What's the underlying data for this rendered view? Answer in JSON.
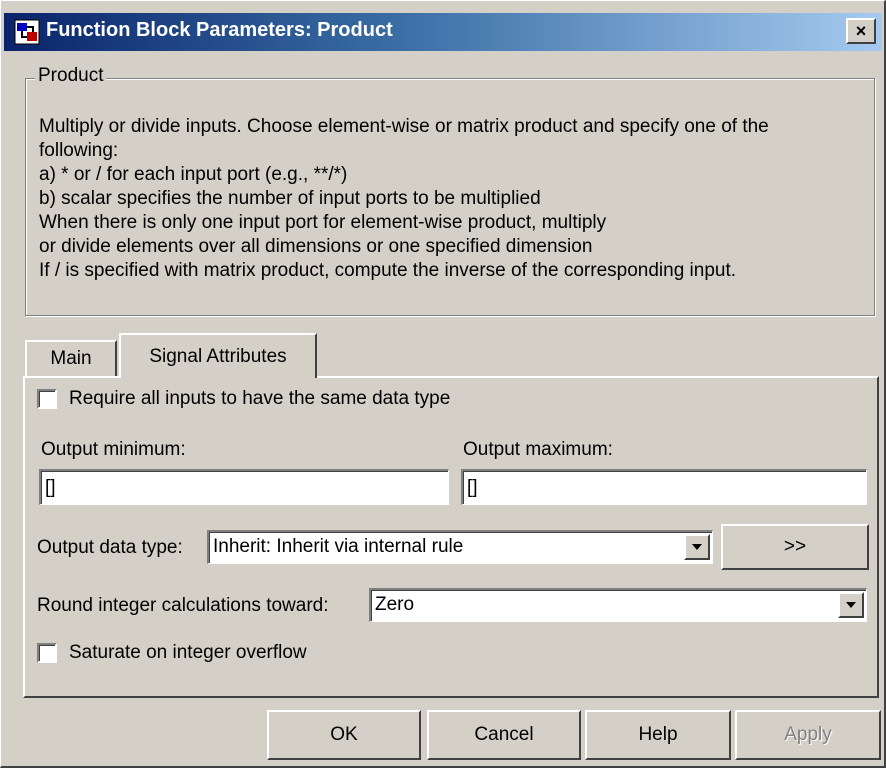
{
  "window": {
    "title": "Function Block Parameters: Product",
    "close_label": "×"
  },
  "group": {
    "title": "Product",
    "description": [
      "Multiply or divide inputs.  Choose element-wise or matrix product and specify one of the",
      "following:",
      "a) * or / for each input port (e.g., **/*)",
      "b) scalar specifies the number of input ports to be multiplied",
      "When there is only one input port for element-wise product, multiply",
      "or divide elements over all dimensions or one specified dimension",
      "If / is specified with matrix product, compute the inverse of the corresponding input."
    ]
  },
  "tabs": [
    {
      "label": "Main",
      "active": false
    },
    {
      "label": "Signal Attributes",
      "active": true
    }
  ],
  "signal_attributes": {
    "require_same_type": {
      "label": "Require all inputs to have the same data type",
      "checked": false
    },
    "output_minimum": {
      "label": "Output minimum:",
      "value": "[]"
    },
    "output_maximum": {
      "label": "Output maximum:",
      "value": "[]"
    },
    "output_data_type": {
      "label": "Output data type:",
      "value": "Inherit: Inherit via internal rule",
      "expand_label": ">>"
    },
    "round_toward": {
      "label": "Round integer calculations toward:",
      "value": "Zero"
    },
    "saturate": {
      "label": "Saturate on integer overflow",
      "checked": false
    }
  },
  "buttons": {
    "ok": "OK",
    "cancel": "Cancel",
    "help": "Help",
    "apply": "Apply"
  },
  "colors": {
    "face": "#d4d0c8",
    "title_start": "#0a246a",
    "title_end": "#a6caf0"
  }
}
